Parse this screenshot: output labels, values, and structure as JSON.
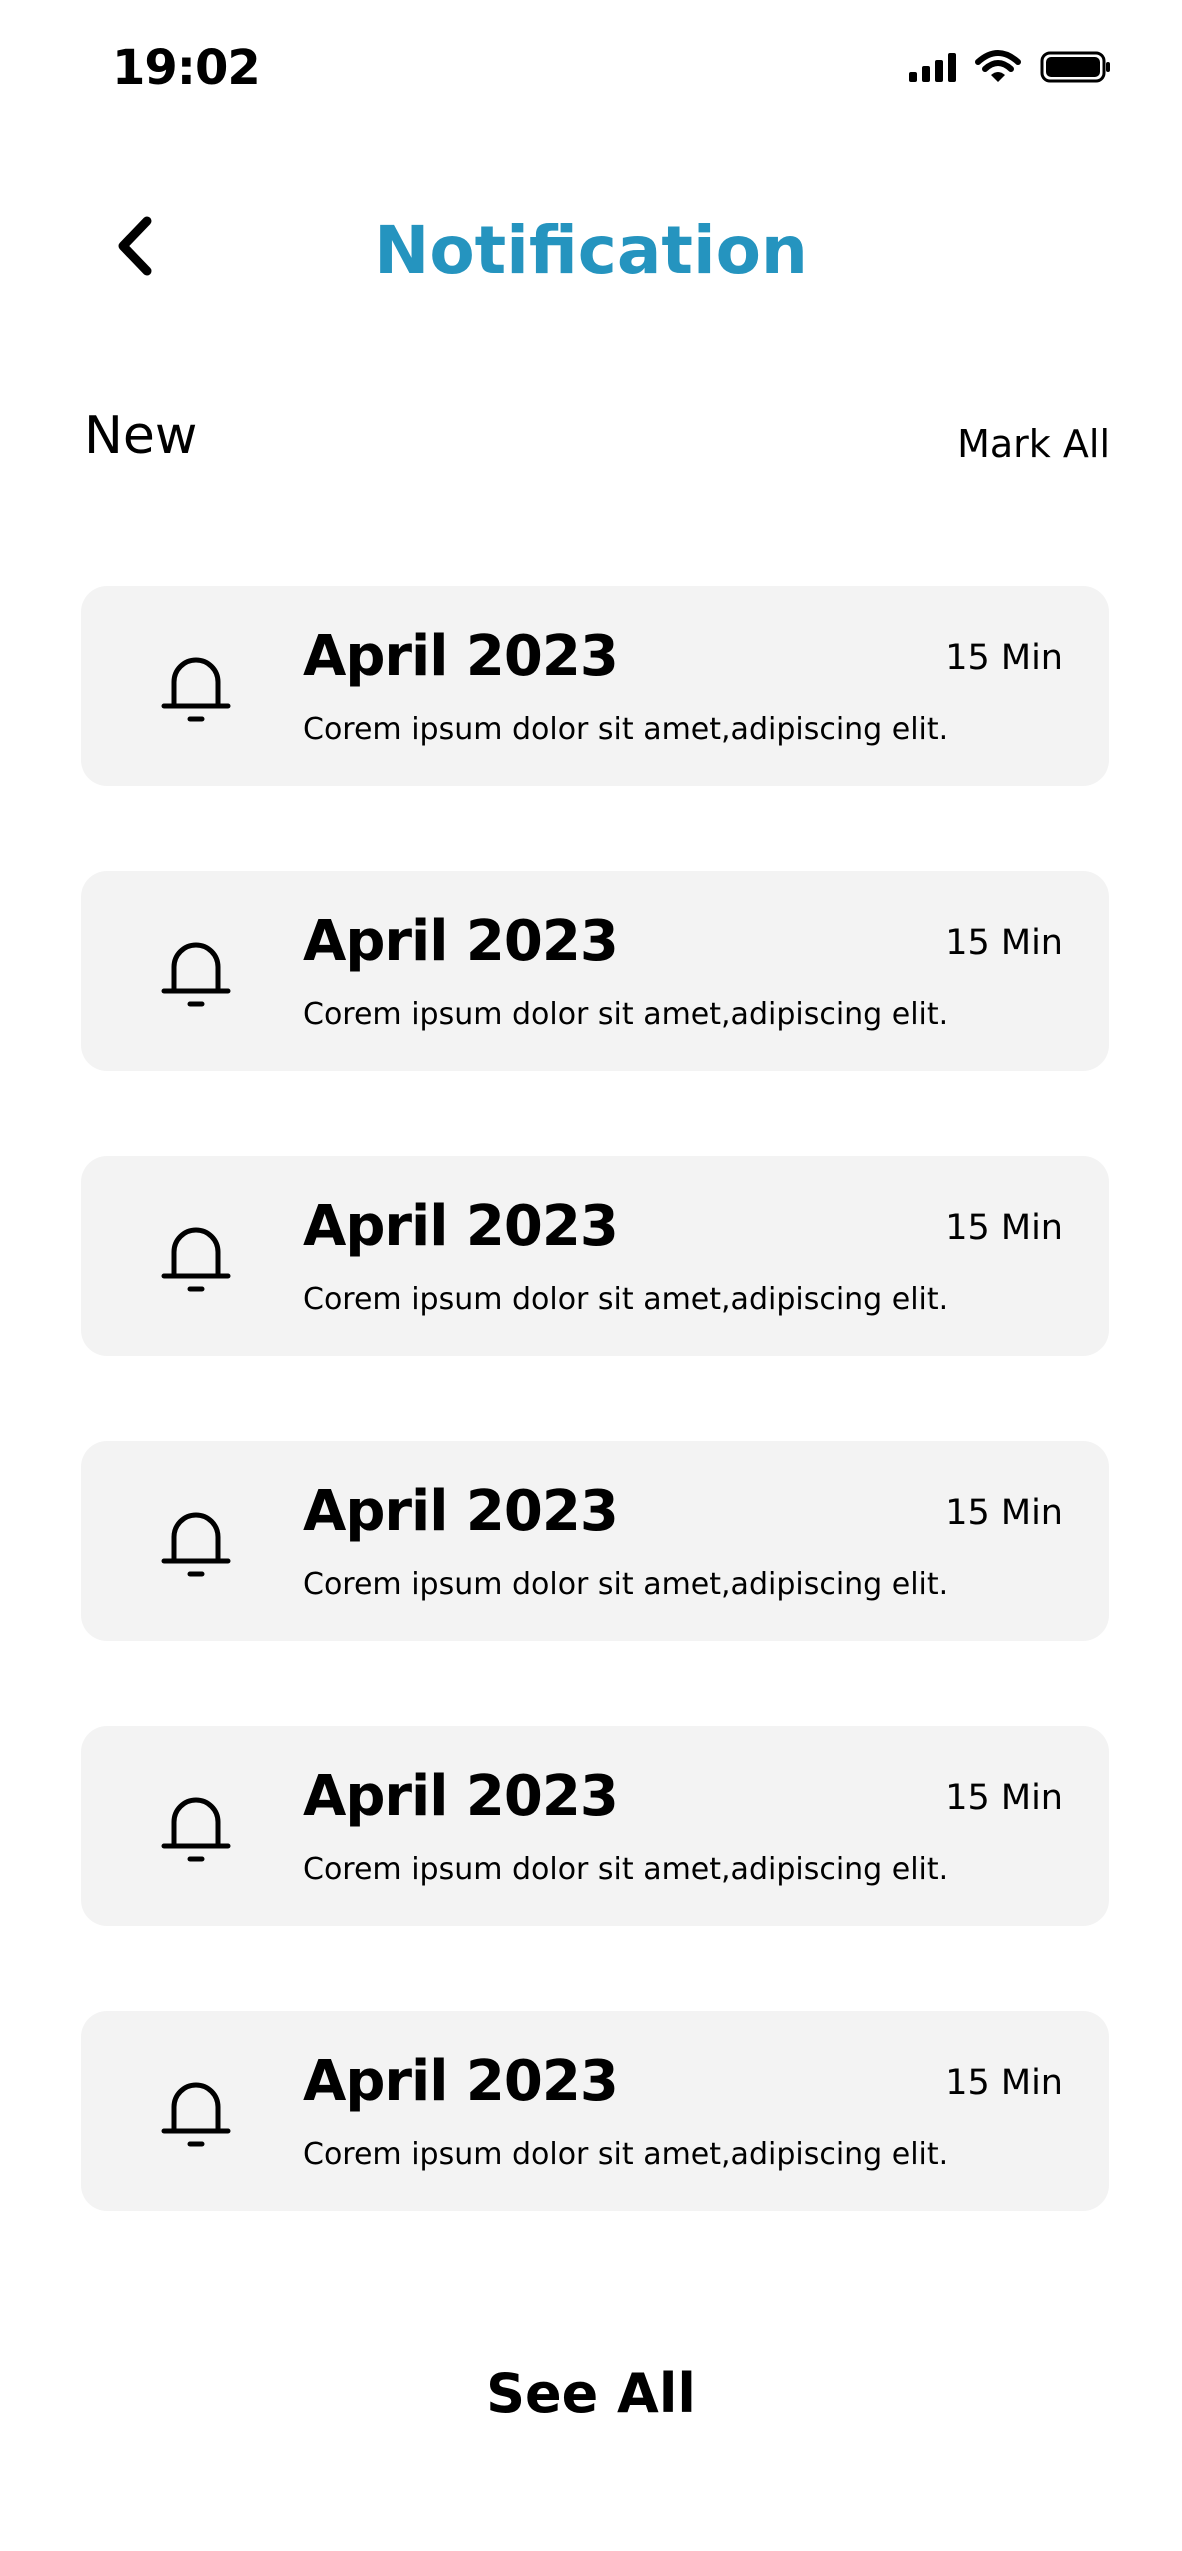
{
  "status_bar": {
    "time": "19:02"
  },
  "header": {
    "title": "Notification",
    "back_icon": "chevron-left-icon"
  },
  "section": {
    "title": "New",
    "mark_all_label": "Mark All"
  },
  "notifications": [
    {
      "title": "April 2023",
      "text": "Corem ipsum dolor sit amet,adipiscing elit.",
      "time": "15 Min",
      "icon": "bell-icon"
    },
    {
      "title": "April 2023",
      "text": "Corem ipsum dolor sit amet,adipiscing elit.",
      "time": "15 Min",
      "icon": "bell-icon"
    },
    {
      "title": "April 2023",
      "text": "Corem ipsum dolor sit amet,adipiscing elit.",
      "time": "15 Min",
      "icon": "bell-icon"
    },
    {
      "title": "April 2023",
      "text": "Corem ipsum dolor sit amet,adipiscing elit.",
      "time": "15 Min",
      "icon": "bell-icon"
    },
    {
      "title": "April 2023",
      "text": "Corem ipsum dolor sit amet,adipiscing elit.",
      "time": "15 Min",
      "icon": "bell-icon"
    },
    {
      "title": "April 2023",
      "text": "Corem ipsum dolor sit amet,adipiscing elit.",
      "time": "15 Min",
      "icon": "bell-icon"
    }
  ],
  "footer": {
    "see_all_label": "See All"
  },
  "colors": {
    "accent": "#2594bf",
    "card_background": "#f3f3f3"
  }
}
